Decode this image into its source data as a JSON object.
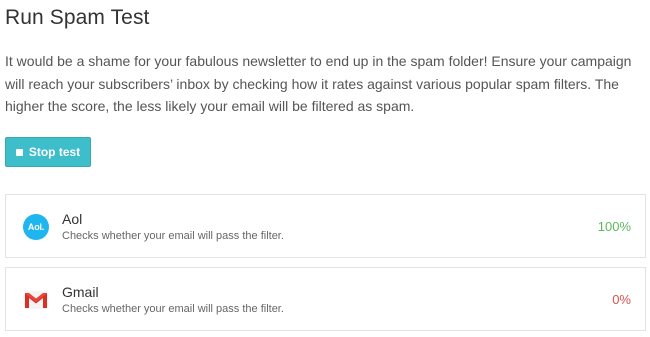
{
  "page": {
    "title": "Run Spam Test",
    "description": "It would be a shame for your fabulous newsletter to end up in the spam folder! Ensure your campaign will reach your subscribers’ inbox by checking how it rates against various popular spam filters. The higher the score, the less likely your email will be filtered as spam."
  },
  "actions": {
    "stop_label": "Stop test",
    "stop_icon": "stop-icon",
    "button_color": "#3ebdcb"
  },
  "filters": [
    {
      "name": "Aol",
      "logo_text": "Aol.",
      "icon": "aol-logo-icon",
      "subtitle": "Checks whether your email will pass the filter.",
      "score": "100%",
      "score_color": "#5cb85c"
    },
    {
      "name": "Gmail",
      "icon": "gmail-logo-icon",
      "subtitle": "Checks whether your email will pass the filter.",
      "score": "0%",
      "score_color": "#d9534f"
    }
  ]
}
